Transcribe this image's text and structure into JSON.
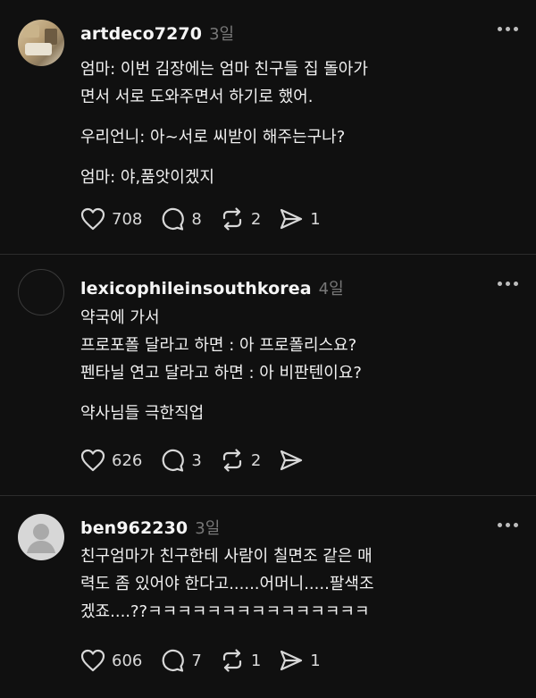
{
  "posts": [
    {
      "username": "artdeco7270",
      "time": "3일",
      "lines": [
        "엄마: 이번 김장에는 엄마 친구들 집 돌아가",
        "면서 서로 도와주면서 하기로 했어."
      ],
      "lines2": [
        "우리언니: 아~서로 씨받이 해주는구나?"
      ],
      "lines3": [
        "엄마: 야,품앗이겠지"
      ],
      "likes": "708",
      "comments": "8",
      "reposts": "2",
      "shares": "1"
    },
    {
      "username": "lexicophileinsouthkorea",
      "time": "4일",
      "lines": [
        "약국에 가서",
        "프로포폴 달라고 하면 : 아 프로폴리스요?",
        "펜타닐 연고 달라고 하면 : 아 비판텐이요?"
      ],
      "lines2": [
        "약사님들 극한직업"
      ],
      "likes": "626",
      "comments": "3",
      "reposts": "2",
      "shares": ""
    },
    {
      "username": "ben962230",
      "time": "3일",
      "lines": [
        "친구엄마가 친구한테 사람이 칠면조 같은 매",
        "력도 좀 있어야 한다고......어머니.....팔색조",
        "겠죠....??ㅋㅋㅋㅋㅋㅋㅋㅋㅋㅋㅋㅋㅋㅋㅋ"
      ],
      "likes": "606",
      "comments": "7",
      "reposts": "1",
      "shares": "1"
    }
  ],
  "icons": {
    "like": "heart-icon",
    "comment": "comment-bubble-icon",
    "repost": "repost-icon",
    "share": "send-icon",
    "more": "more-dots-icon"
  }
}
